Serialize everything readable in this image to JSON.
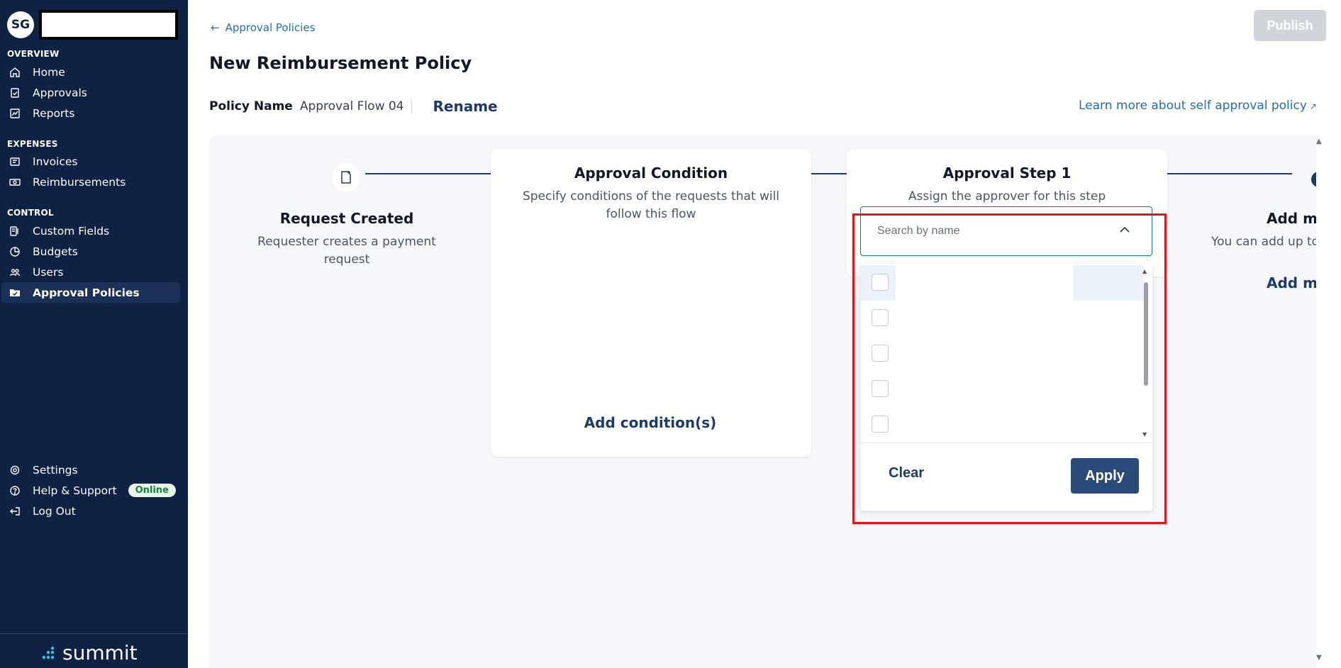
{
  "sidebar": {
    "avatar_initials": "SG",
    "sections": {
      "overview": "OVERVIEW",
      "expenses": "EXPENSES",
      "control": "CONTROL"
    },
    "items": {
      "home": "Home",
      "approvals": "Approvals",
      "reports": "Reports",
      "invoices": "Invoices",
      "reimbursements": "Reimbursements",
      "custom_fields": "Custom Fields",
      "budgets": "Budgets",
      "users": "Users",
      "approval_policies": "Approval Policies",
      "settings": "Settings",
      "help_support": "Help & Support",
      "log_out": "Log Out"
    },
    "online_badge": "Online",
    "logo_text": "summit",
    "active_item": "Approval Policies"
  },
  "header": {
    "back_link": "Approval Policies",
    "page_title": "New Reimbursement Policy",
    "publish_label": "Publish",
    "policy_name_label": "Policy Name",
    "policy_name_value": "Approval Flow 04",
    "rename_label": "Rename",
    "learn_more": "Learn more about self approval policy"
  },
  "flow": {
    "request_created": {
      "title": "Request Created",
      "desc": "Requester creates a payment request"
    },
    "approval_condition": {
      "title": "Approval Condition",
      "desc": "Specify conditions of the requests that will follow this flow",
      "add_label": "Add condition(s)"
    },
    "approval_step": {
      "title": "Approval Step 1",
      "desc": "Assign the approver for this step",
      "search_placeholder": "Search by name",
      "clear_label": "Clear",
      "apply_label": "Apply",
      "option_count_visible": 5
    },
    "add_more": {
      "title": "Add mo",
      "desc": "You can add up to",
      "link": "Add mo"
    }
  },
  "colors": {
    "sidebar_bg": "#0f2244",
    "accent": "#1e3a66",
    "link": "#1f6fb5",
    "highlight": "#e5141b"
  }
}
